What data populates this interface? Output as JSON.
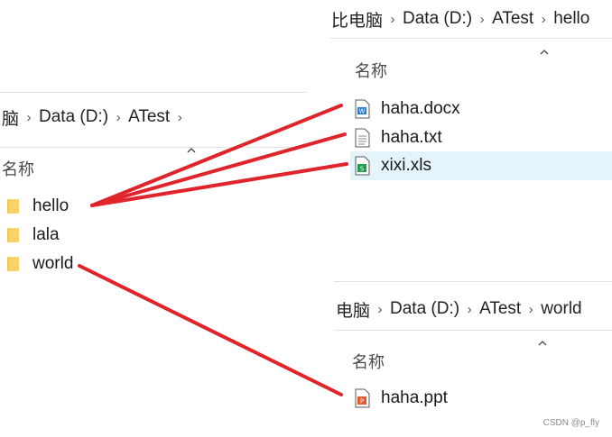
{
  "left_window": {
    "breadcrumb": [
      "脑",
      "Data (D:)",
      "ATest"
    ],
    "column_header": "名称",
    "folders": [
      {
        "name": "hello"
      },
      {
        "name": "lala"
      },
      {
        "name": "world"
      }
    ]
  },
  "top_right_window": {
    "breadcrumb": [
      "比电脑",
      "Data (D:)",
      "ATest",
      "hello"
    ],
    "column_header": "名称",
    "files": [
      {
        "name": "haha.docx",
        "icon": "word-doc-icon"
      },
      {
        "name": "haha.txt",
        "icon": "text-file-icon"
      },
      {
        "name": "xixi.xls",
        "icon": "spreadsheet-icon",
        "selected": true
      }
    ]
  },
  "bottom_right_window": {
    "breadcrumb": [
      "电脑",
      "Data (D:)",
      "ATest",
      "world"
    ],
    "column_header": "名称",
    "files": [
      {
        "name": "haha.ppt",
        "icon": "presentation-icon"
      }
    ]
  },
  "annotation_color": "#e0242b",
  "watermark": "CSDN @p_fly"
}
